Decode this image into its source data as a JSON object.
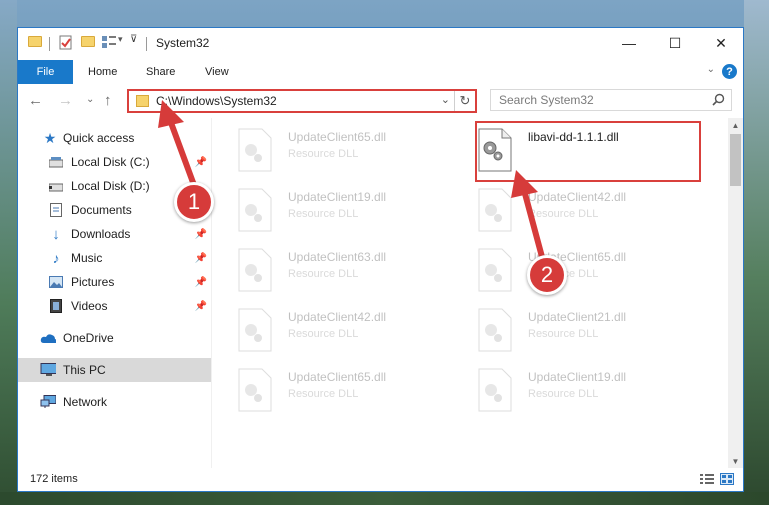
{
  "window": {
    "title": "System32",
    "min_glyph": "—",
    "max_glyph": "☐",
    "close_glyph": "✕"
  },
  "ribbon": {
    "tabs": [
      "File",
      "Home",
      "Share",
      "View"
    ],
    "expand_glyph": "⌄",
    "help_glyph": "?"
  },
  "nav": {
    "back_glyph": "←",
    "forward_glyph": "→",
    "recent_glyph": "⌄",
    "up_glyph": "↑",
    "address": "C:\\Windows\\System32",
    "address_drop_glyph": "⌄",
    "refresh_glyph": "↻",
    "search_placeholder": "Search System32"
  },
  "sidebar": {
    "items": [
      {
        "label": "Quick access",
        "icon": "star-icon"
      },
      {
        "label": "Local Disk (C:)",
        "icon": "drive-icon"
      },
      {
        "label": "Local Disk (D:)",
        "icon": "drive-icon"
      },
      {
        "label": "Documents",
        "icon": "documents-icon"
      },
      {
        "label": "Downloads",
        "icon": "download-icon"
      },
      {
        "label": "Music",
        "icon": "music-icon"
      },
      {
        "label": "Pictures",
        "icon": "pictures-icon"
      },
      {
        "label": "Videos",
        "icon": "videos-icon"
      },
      {
        "label": "OneDrive",
        "icon": "cloud-icon"
      },
      {
        "label": "This PC",
        "icon": "computer-icon"
      },
      {
        "label": "Network",
        "icon": "network-icon"
      }
    ],
    "pin_glyph": "📌"
  },
  "files": {
    "left_column": [
      {
        "name": "UpdateClient65.dll",
        "type": "Resource DLL"
      },
      {
        "name": "UpdateClient19.dll",
        "type": "Resource DLL"
      },
      {
        "name": "UpdateClient63.dll",
        "type": "Resource DLL"
      },
      {
        "name": "UpdateClient42.dll",
        "type": "Resource DLL"
      },
      {
        "name": "UpdateClient65.dll",
        "type": "Resource DLL"
      }
    ],
    "right_column": [
      {
        "name": "libavi-dd-1.1.1.dll",
        "type": ""
      },
      {
        "name": "UpdateClient42.dll",
        "type": "Resource DLL"
      },
      {
        "name": "UpdateClient65.dll",
        "type": "Resource DLL"
      },
      {
        "name": "UpdateClient21.dll",
        "type": "Resource DLL"
      },
      {
        "name": "UpdateClient19.dll",
        "type": "Resource DLL"
      }
    ]
  },
  "status": {
    "item_count": "172 items"
  },
  "annotations": {
    "step1": "1",
    "step2": "2"
  },
  "colors": {
    "accent": "#1979ca",
    "highlight": "#d9403c",
    "badge": "#d63b3a"
  }
}
